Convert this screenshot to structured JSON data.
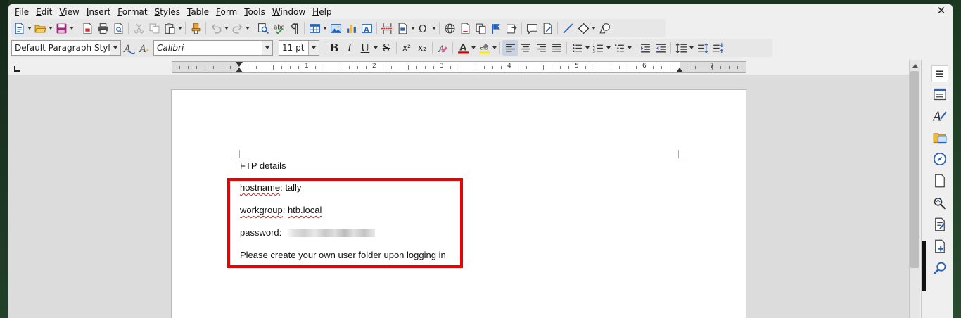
{
  "menu": [
    "File",
    "Edit",
    "View",
    "Insert",
    "Format",
    "Styles",
    "Table",
    "Form",
    "Tools",
    "Window",
    "Help"
  ],
  "window": {
    "close_glyph": "✕"
  },
  "toolbar_standard": {
    "icons": [
      "new-document-icon",
      "open-folder-icon",
      "save-icon",
      "export-pdf-icon",
      "print-icon",
      "print-preview-icon",
      "cut-icon",
      "copy-icon",
      "paste-icon",
      "clone-formatting-icon",
      "undo-icon",
      "redo-icon",
      "find-replace-icon",
      "spellcheck-icon",
      "formatting-marks-icon",
      "insert-table-icon",
      "insert-image-icon",
      "insert-chart-icon",
      "insert-textbox-icon",
      "page-break-icon",
      "insert-field-icon",
      "special-character-icon",
      "hyperlink-icon",
      "footnote-icon",
      "cross-reference-icon",
      "bookmark-icon",
      "comment-icon",
      "track-changes-icon",
      "line-icon",
      "basic-shapes-icon",
      "draw-functions-icon"
    ]
  },
  "toolbar_formatting": {
    "paragraph_style": "Default Paragraph Style",
    "font_name": "Calibri",
    "font_size": "11 pt",
    "bold_label": "B",
    "italic_label": "I",
    "underline_label": "U",
    "strike_label": "S",
    "superscript_label": "x²",
    "subscript_label": "x₂",
    "font_color": "#d40000",
    "highlight_color": "#ffee00",
    "alignment": "left"
  },
  "ruler": {
    "numbers": [
      "1",
      "2",
      "3",
      "4",
      "5",
      "6",
      "7"
    ]
  },
  "document": {
    "title_line": "FTP details",
    "hostname_key": "hostname",
    "hostname_value": ": tally",
    "workgroup_key": "workgroup",
    "workgroup_value_prefix": ": ",
    "workgroup_value": "htb.local",
    "password_label": "password:",
    "password_value": "[redacted]",
    "note": "Please create your own user folder upon logging in"
  },
  "annotation": {
    "highlight_color": "#ee0000"
  },
  "sidebar": {
    "icons": [
      "sidebar-menu-icon",
      "properties-icon",
      "styles-icon",
      "gallery-icon",
      "navigator-icon",
      "page-icon",
      "style-inspector-icon",
      "manage-changes-icon",
      "design-icon",
      "find-icon"
    ]
  }
}
